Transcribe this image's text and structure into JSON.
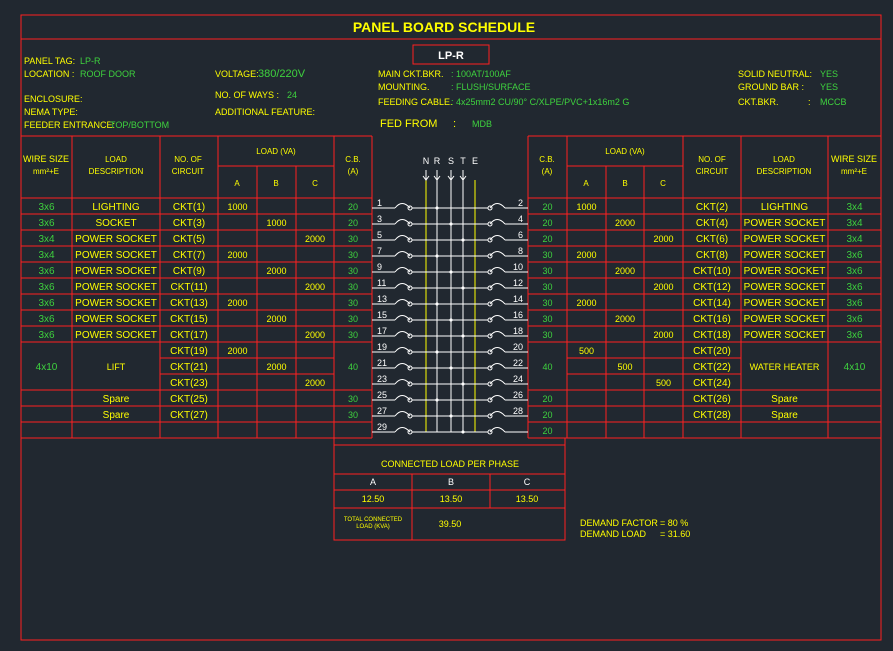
{
  "title": "PANEL BOARD SCHEDULE",
  "panel_id": "LP-R",
  "header": {
    "panel_tag_label": "PANEL TAG:",
    "panel_tag_value": "LP-R",
    "location_label": "LOCATION :",
    "location_value": "ROOF DOOR",
    "enclosure_label": "ENCLOSURE:",
    "nema_label": "NEMA TYPE:",
    "feeder_entrance_label": "FEEDER ENTRANCE:",
    "feeder_entrance_value": "TOP/BOTTOM",
    "voltage_label": "VOLTAGE:",
    "voltage_value": "380/220V",
    "ways_label": "NO. OF WAYS :",
    "ways_value": "24",
    "additional_label": "ADDITIONAL FEATURE:",
    "main_label": "MAIN CKT.BKR.",
    "main_value": ": 100AT/100AF",
    "mounting_label": "MOUNTING.",
    "mounting_value": ": FLUSH/SURFACE",
    "feeding_label": "FEEDING CABLE.",
    "feeding_value": ": 4x25mm2 CU/90° C/XLPE/PVC+1x16m2 G",
    "fed_from_label": "FED FROM",
    "fed_from_sep": ":",
    "fed_from_value": "MDB",
    "solid_neutral_label": "SOLID NEUTRAL:",
    "solid_neutral_value": "YES",
    "ground_bar_label": "GROUND BAR :",
    "ground_bar_value": "YES",
    "ckt_bkr_label": "CKT.BKR.",
    "ckt_bkr_sep": ":",
    "ckt_bkr_value": "MCCB"
  },
  "table_headers": {
    "wire_size": "WIRE SIZE",
    "wire_unit": "mm²+E",
    "load_desc_1": "LOAD",
    "load_desc_2": "DESCRIPTION",
    "no_of_1": "NO. OF",
    "no_of_2": "CIRCUIT",
    "load_va": "LOAD (VA)",
    "phase_a": "A",
    "phase_b": "B",
    "phase_c": "C",
    "cb_1": "C.B.",
    "cb_2": "(A)"
  },
  "bus_labels": [
    "N",
    "R",
    "S",
    "T",
    "E"
  ],
  "left_rows": [
    {
      "wire": "3x6",
      "desc": "LIGHTING",
      "ckt": "CKT(1)",
      "a": "1000",
      "b": "",
      "c": "",
      "cb": "20",
      "num": "1"
    },
    {
      "wire": "3x6",
      "desc": "SOCKET",
      "ckt": "CKT(3)",
      "a": "",
      "b": "1000",
      "c": "",
      "cb": "20",
      "num": "3"
    },
    {
      "wire": "3x4",
      "desc": "POWER SOCKET",
      "ckt": "CKT(5)",
      "a": "",
      "b": "",
      "c": "2000",
      "cb": "30",
      "num": "5"
    },
    {
      "wire": "3x4",
      "desc": "POWER SOCKET",
      "ckt": "CKT(7)",
      "a": "2000",
      "b": "",
      "c": "",
      "cb": "30",
      "num": "7"
    },
    {
      "wire": "3x6",
      "desc": "POWER SOCKET",
      "ckt": "CKT(9)",
      "a": "",
      "b": "2000",
      "c": "",
      "cb": "30",
      "num": "9"
    },
    {
      "wire": "3x6",
      "desc": "POWER SOCKET",
      "ckt": "CKT(11)",
      "a": "",
      "b": "",
      "c": "2000",
      "cb": "30",
      "num": "11"
    },
    {
      "wire": "3x6",
      "desc": "POWER SOCKET",
      "ckt": "CKT(13)",
      "a": "2000",
      "b": "",
      "c": "",
      "cb": "30",
      "num": "13"
    },
    {
      "wire": "3x6",
      "desc": "POWER SOCKET",
      "ckt": "CKT(15)",
      "a": "",
      "b": "2000",
      "c": "",
      "cb": "30",
      "num": "15"
    },
    {
      "wire": "3x6",
      "desc": "POWER SOCKET",
      "ckt": "CKT(17)",
      "a": "",
      "b": "",
      "c": "2000",
      "cb": "30",
      "num": "17"
    },
    {
      "wire": "",
      "desc": "",
      "ckt": "CKT(19)",
      "a": "2000",
      "b": "",
      "c": "",
      "cb": "",
      "num": "19"
    },
    {
      "wire": "",
      "desc": "",
      "ckt": "CKT(21)",
      "a": "",
      "b": "2000",
      "c": "",
      "cb": "",
      "num": "21"
    },
    {
      "wire": "",
      "desc": "",
      "ckt": "CKT(23)",
      "a": "",
      "b": "",
      "c": "2000",
      "cb": "",
      "num": "23"
    },
    {
      "wire": "",
      "desc": "Spare",
      "ckt": "CKT(25)",
      "a": "",
      "b": "",
      "c": "",
      "cb": "30",
      "num": "25"
    },
    {
      "wire": "",
      "desc": "Spare",
      "ckt": "CKT(27)",
      "a": "",
      "b": "",
      "c": "",
      "cb": "30",
      "num": "27"
    },
    {
      "wire": "",
      "desc": "",
      "ckt": "",
      "a": "",
      "b": "",
      "c": "",
      "cb": "",
      "num": "29"
    }
  ],
  "left_group": {
    "wire": "4x10",
    "desc": "LIFT",
    "cb": "40"
  },
  "right_rows": [
    {
      "wire": "3x4",
      "desc": "LIGHTING",
      "ckt": "CKT(2)",
      "a": "1000",
      "b": "",
      "c": "",
      "cb": "20",
      "num": "2"
    },
    {
      "wire": "3x4",
      "desc": "POWER SOCKET",
      "ckt": "CKT(4)",
      "a": "",
      "b": "2000",
      "c": "",
      "cb": "20",
      "num": "4"
    },
    {
      "wire": "3x4",
      "desc": "POWER SOCKET",
      "ckt": "CKT(6)",
      "a": "",
      "b": "",
      "c": "2000",
      "cb": "20",
      "num": "6"
    },
    {
      "wire": "3x6",
      "desc": "POWER SOCKET",
      "ckt": "CKT(8)",
      "a": "2000",
      "b": "",
      "c": "",
      "cb": "30",
      "num": "8"
    },
    {
      "wire": "3x6",
      "desc": "POWER SOCKET",
      "ckt": "CKT(10)",
      "a": "",
      "b": "2000",
      "c": "",
      "cb": "30",
      "num": "10"
    },
    {
      "wire": "3x6",
      "desc": "POWER SOCKET",
      "ckt": "CKT(12)",
      "a": "",
      "b": "",
      "c": "2000",
      "cb": "30",
      "num": "12"
    },
    {
      "wire": "3x6",
      "desc": "POWER SOCKET",
      "ckt": "CKT(14)",
      "a": "2000",
      "b": "",
      "c": "",
      "cb": "30",
      "num": "14"
    },
    {
      "wire": "3x6",
      "desc": "POWER SOCKET",
      "ckt": "CKT(16)",
      "a": "",
      "b": "2000",
      "c": "",
      "cb": "30",
      "num": "16"
    },
    {
      "wire": "3x6",
      "desc": "POWER SOCKET",
      "ckt": "CKT(18)",
      "a": "",
      "b": "",
      "c": "2000",
      "cb": "30",
      "num": "18"
    },
    {
      "wire": "",
      "desc": "",
      "ckt": "CKT(20)",
      "a": "500",
      "b": "",
      "c": "",
      "cb": "",
      "num": "20"
    },
    {
      "wire": "",
      "desc": "",
      "ckt": "CKT(22)",
      "a": "",
      "b": "500",
      "c": "",
      "cb": "",
      "num": "22"
    },
    {
      "wire": "",
      "desc": "",
      "ckt": "CKT(24)",
      "a": "",
      "b": "",
      "c": "500",
      "cb": "",
      "num": "24"
    },
    {
      "wire": "",
      "desc": "Spare",
      "ckt": "CKT(26)",
      "a": "",
      "b": "",
      "c": "",
      "cb": "20",
      "num": "26"
    },
    {
      "wire": "",
      "desc": "Spare",
      "ckt": "CKT(28)",
      "a": "",
      "b": "",
      "c": "",
      "cb": "20",
      "num": "28"
    },
    {
      "wire": "",
      "desc": "",
      "ckt": "",
      "a": "",
      "b": "",
      "c": "",
      "cb": "20",
      "num": ""
    }
  ],
  "right_group": {
    "wire": "4x10",
    "desc": "WATER HEATER",
    "cb": "40"
  },
  "summary": {
    "title": "CONNECTED LOAD PER PHASE",
    "phase_a": "A",
    "phase_b": "B",
    "phase_c": "C",
    "load_a": "12.50",
    "load_b": "13.50",
    "load_c": "13.50",
    "total_label_1": "TOTAL CONNECTED",
    "total_label_2": "LOAD (KVA)",
    "total_value": "39.50"
  },
  "demand": {
    "factor_label": "DEMAND FACTOR",
    "factor_value": "=  80 %",
    "load_label": "DEMAND LOAD",
    "load_value": "=  31.60"
  },
  "colors": {
    "background": "#212830",
    "line": "#ff2020",
    "text_yellow": "#ffff00",
    "text_green": "#3ed23e",
    "text_white": "#ffffff"
  }
}
